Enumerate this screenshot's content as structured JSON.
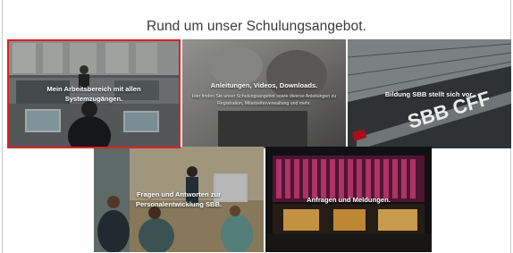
{
  "page": {
    "title": "Rund um unser Schulungsangebot."
  },
  "tiles": [
    {
      "id": "arbeitsbereich",
      "title": "Mein Arbeitsbereich mit allen\nSystemzugängen.",
      "subtitle": ""
    },
    {
      "id": "anleitungen",
      "title": "Anleitungen, Videos, Downloads.",
      "subtitle": "Hier finden Sie unser Schulungsangebot sowie diverse Anleitungen zu\nRegistration, Mitarbeiterverwaltung und mehr."
    },
    {
      "id": "bildung",
      "title": "Bildung SBB stellt sich vor.",
      "subtitle": ""
    },
    {
      "id": "personalentwicklung",
      "title": "Fragen und Antworten zur\nPersonalentwicklung SBB.",
      "subtitle": ""
    },
    {
      "id": "anfragen",
      "title": "Anfragen und Meldungen.",
      "subtitle": ""
    }
  ],
  "sign_text": "SBB CFF",
  "colors": {
    "selection": "#e02020",
    "title_text": "#3a3a3a",
    "sbb_red": "#d0141e"
  }
}
